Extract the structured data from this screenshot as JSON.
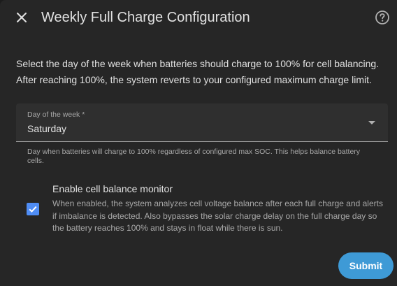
{
  "dialog": {
    "title": "Weekly Full Charge Configuration",
    "close_icon": "close-icon",
    "help_icon": "help-circle-icon",
    "description_line1": "Select the day of the week when batteries should charge to 100% for cell balancing.",
    "description_line2": "After reaching 100%, the system reverts to your configured maximum charge limit."
  },
  "day_select": {
    "label": "Day of the week *",
    "value": "Saturday",
    "arrow_icon": "dropdown-arrow-icon",
    "helper_text": "Day when batteries will charge to 100% regardless of configured max SOC. This helps balance battery cells."
  },
  "balance_monitor": {
    "checked": true,
    "label": "Enable cell balance monitor",
    "description": "When enabled, the system analyzes cell voltage balance after each full charge and alerts if imbalance is detected. Also bypasses the solar charge delay on the full charge day so the battery reaches 100% and stays in float while there is sun."
  },
  "actions": {
    "submit_label": "Submit"
  },
  "colors": {
    "background": "#262626",
    "accent_checkbox": "#4f8df5",
    "submit_button": "#3e9ad6"
  }
}
